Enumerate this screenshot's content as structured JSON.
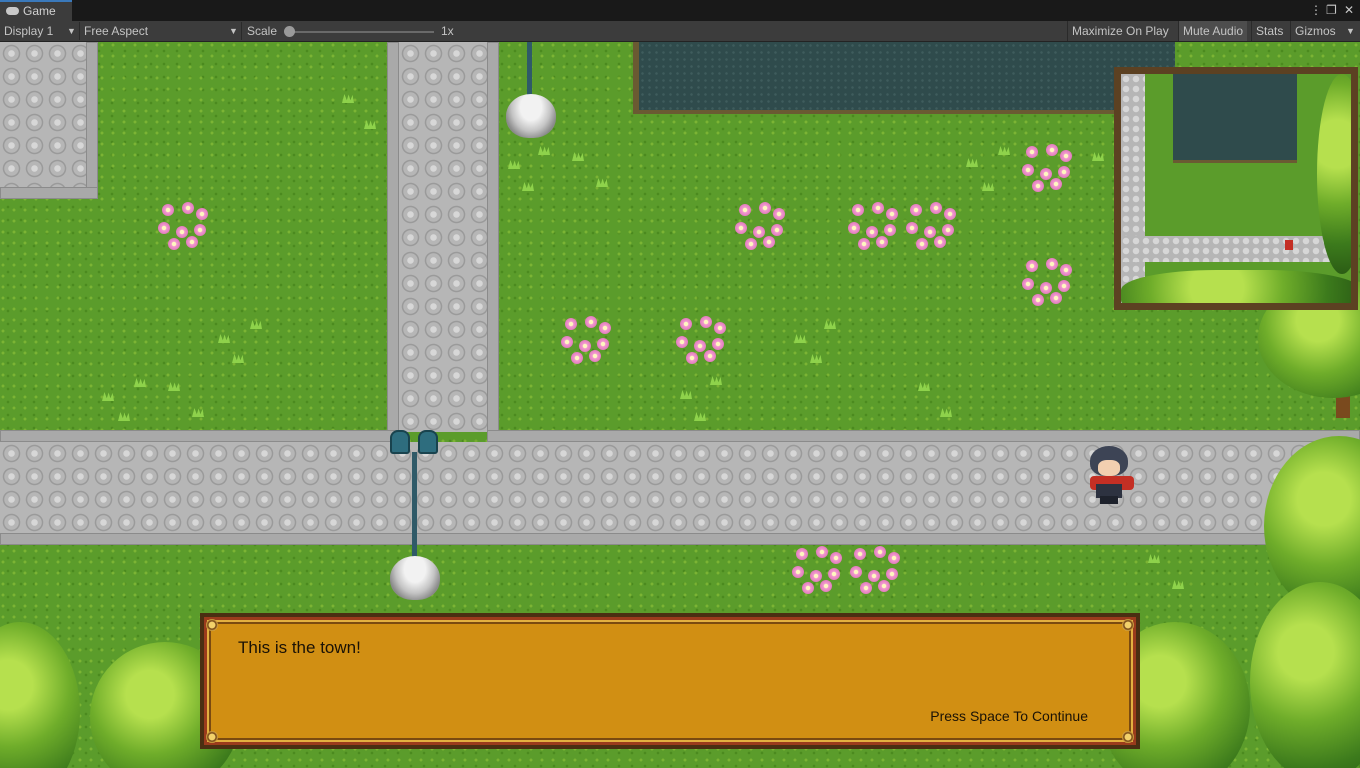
{
  "window": {
    "tab_title": "Game",
    "tab_icon": "gamepad-icon",
    "controls": {
      "more": "⋮",
      "maximize": "❐",
      "close": "✕"
    }
  },
  "toolbar": {
    "display": "Display 1",
    "aspect": "Free Aspect",
    "scale_label": "Scale",
    "scale_value": "1x",
    "scale_fraction": 0.0,
    "buttons": [
      {
        "label": "Maximize On Play",
        "active": false
      },
      {
        "label": "Mute Audio",
        "active": true
      },
      {
        "label": "Stats",
        "active": false
      },
      {
        "label": "Gizmos",
        "active": false
      }
    ]
  },
  "dialog": {
    "text": "This is the town!",
    "hint": "Press Space To Continue"
  },
  "colors": {
    "grass": "#5b9c2b",
    "path": "#b6b6b6",
    "pond": "#2f4b4c",
    "dialog_fill": "#d18f13",
    "minimap_frame": "#5c4122",
    "accent": "#3a79bb"
  }
}
